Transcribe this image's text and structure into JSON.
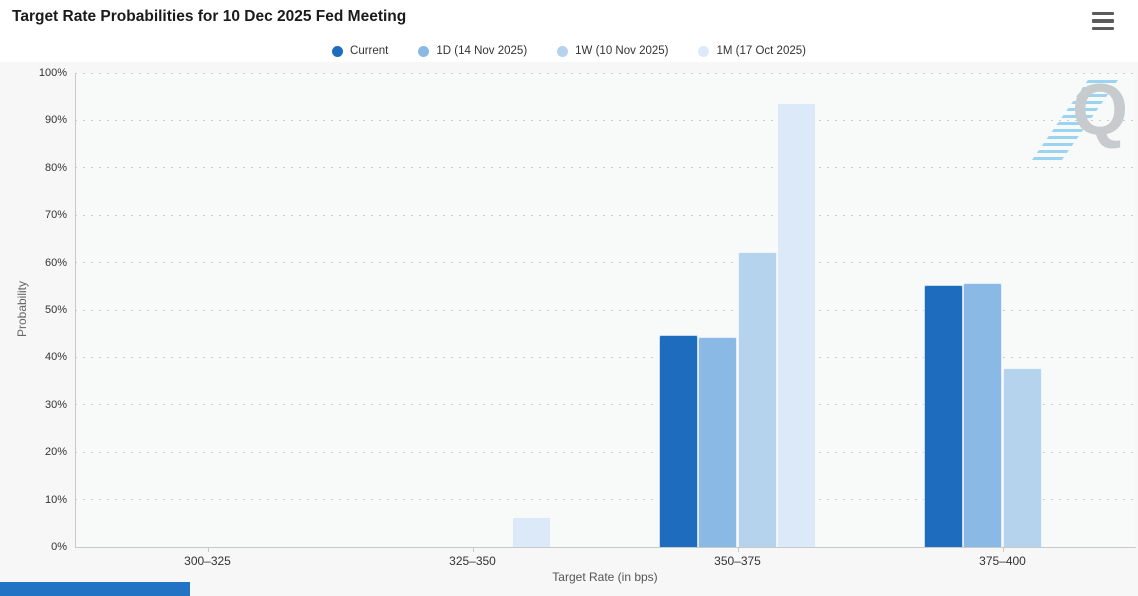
{
  "header": {
    "title": "Target Rate Probabilities for 10 Dec 2025 Fed Meeting",
    "menu_icon": "hamburger-menu-icon"
  },
  "watermark": {
    "letter": "Q"
  },
  "chart_data": {
    "type": "bar",
    "title": "Target Rate Probabilities for 10 Dec 2025 Fed Meeting",
    "categories": [
      "300–325",
      "325–350",
      "350–375",
      "375–400"
    ],
    "series": [
      {
        "name": "Current",
        "color": "#1e6cbe",
        "values": [
          0,
          0,
          44.7,
          55.3
        ]
      },
      {
        "name": "1D (14 Nov 2025)",
        "color": "#8ab9e5",
        "values": [
          0,
          0,
          44.2,
          55.8
        ]
      },
      {
        "name": "1W (10 Nov 2025)",
        "color": "#b6d3ee",
        "values": [
          0,
          0,
          62.3,
          37.7
        ]
      },
      {
        "name": "1M (17 Oct 2025)",
        "color": "#dbe9f8",
        "values": [
          0,
          6.3,
          93.7,
          0
        ]
      }
    ],
    "xlabel": "Target Rate (in bps)",
    "ylabel": "Probability",
    "ylim": [
      0,
      100
    ],
    "ytick_step": 10,
    "yticks": [
      "0%",
      "10%",
      "20%",
      "30%",
      "40%",
      "50%",
      "60%",
      "70%",
      "80%",
      "90%",
      "100%"
    ],
    "grid": true,
    "legend_position": "top"
  },
  "footer": {
    "accent_color": "#2273c4"
  }
}
